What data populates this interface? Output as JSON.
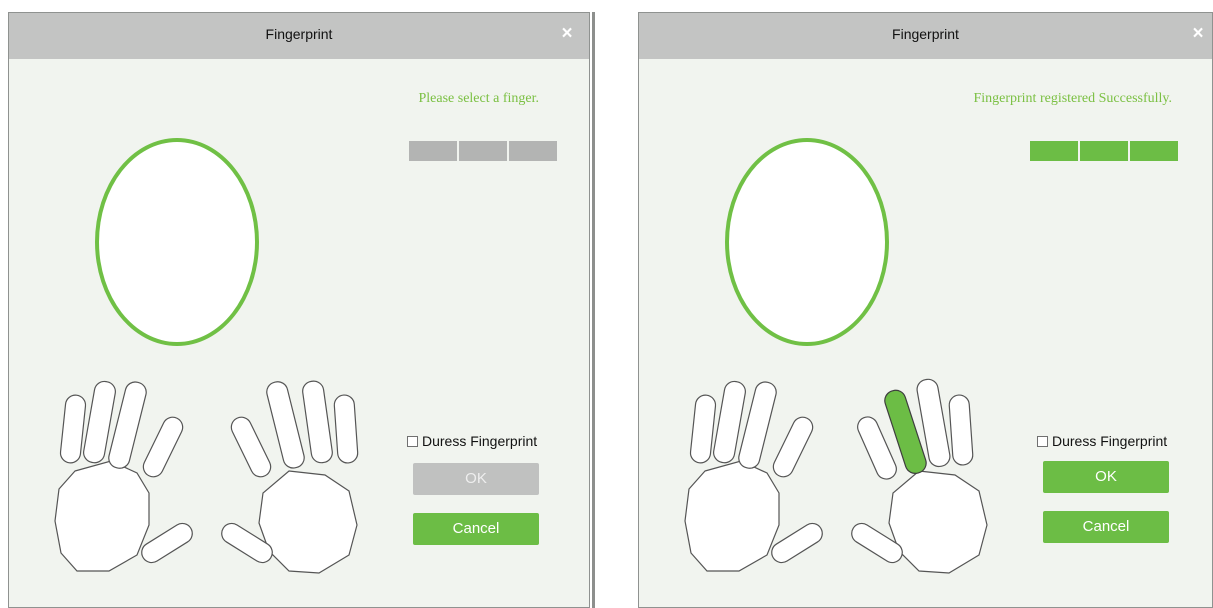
{
  "dialogs": [
    {
      "title": "Fingerprint",
      "close_icon": "×",
      "status_message": "Please select a finger.",
      "status_color": "#7bc043",
      "progress": {
        "filled": 0,
        "total": 3
      },
      "duress_label": "Duress Fingerprint",
      "duress_checked": false,
      "ok_label": "OK",
      "ok_enabled": false,
      "cancel_label": "Cancel",
      "selected_finger": null
    },
    {
      "title": "Fingerprint",
      "close_icon": "×",
      "status_message": "Fingerprint registered Successfully.",
      "status_color": "#7bc043",
      "progress": {
        "filled": 3,
        "total": 3
      },
      "duress_label": "Duress Fingerprint",
      "duress_checked": false,
      "ok_label": "OK",
      "ok_enabled": true,
      "cancel_label": "Cancel",
      "selected_finger": "right-index"
    }
  ],
  "colors": {
    "accent": "#6cbd45",
    "disabled": "#c0c1c0",
    "progress_empty": "#b3b4b3",
    "titlebar": "#c3c4c3",
    "dialog_bg": "#f1f4ef"
  }
}
